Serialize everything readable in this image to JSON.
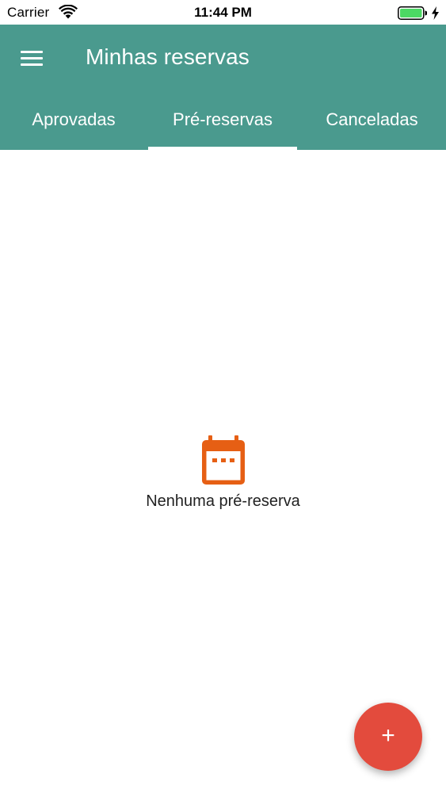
{
  "status_bar": {
    "carrier": "Carrier",
    "time": "11:44 PM",
    "wifi_icon": "wifi-icon",
    "battery_icon": "battery-icon",
    "charge_icon": "charging-bolt-icon",
    "battery_color": "#4cd964"
  },
  "app_bar": {
    "title": "Minhas reservas",
    "menu_icon": "hamburger-menu-icon",
    "background": "#4a9a8e"
  },
  "tabs": [
    {
      "label": "Aprovadas",
      "selected": false
    },
    {
      "label": "Pré-reservas",
      "selected": true
    },
    {
      "label": "Canceladas",
      "selected": false
    }
  ],
  "empty_state": {
    "icon": "calendar-icon",
    "icon_color": "#e65f14",
    "message": "Nenhuma pré-reserva"
  },
  "fab": {
    "icon": "plus-icon",
    "symbol": "+",
    "color": "#e34b3d"
  }
}
